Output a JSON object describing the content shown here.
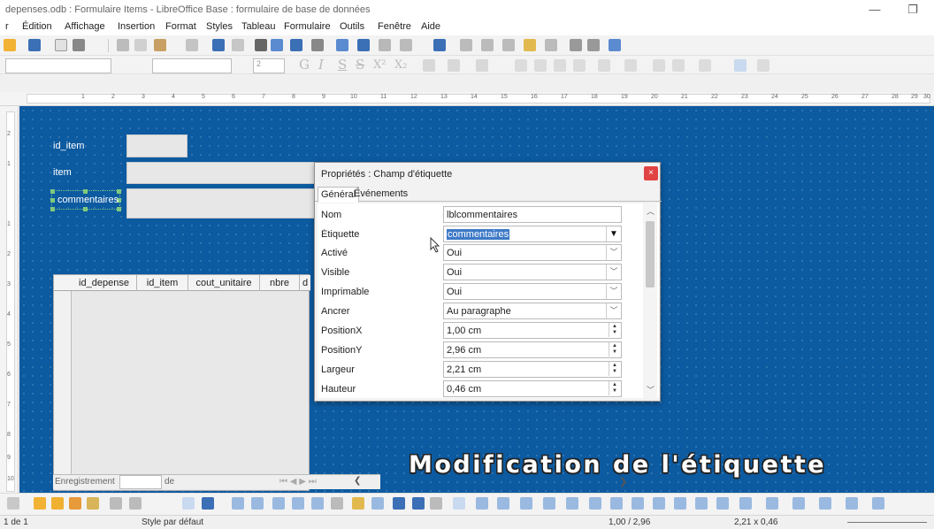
{
  "window": {
    "title": "depenses.odb : Formulaire Items - LibreOffice Base : formulaire de base de données",
    "minimize": "—",
    "restore": "❐"
  },
  "menu": {
    "items": [
      "r",
      "Édition",
      "Affichage",
      "Insertion",
      "Format",
      "Styles",
      "Tableau",
      "Formulaire",
      "Outils",
      "Fenêtre",
      "Aide"
    ]
  },
  "format_toolbar": {
    "font_size": "2",
    "glyphs": [
      "G",
      "I",
      "S",
      "S",
      "X²",
      "X₂"
    ]
  },
  "ruler": {
    "numbers": [
      "1",
      "2",
      "3",
      "4",
      "5",
      "6",
      "7",
      "8",
      "9",
      "10",
      "11",
      "12",
      "13",
      "14",
      "15",
      "16",
      "17",
      "18",
      "19",
      "20",
      "21",
      "22",
      "23",
      "24",
      "25",
      "26",
      "27",
      "28",
      "29",
      "30"
    ],
    "vnumbers": [
      "2",
      "1",
      "1",
      "2",
      "3",
      "4",
      "5",
      "6",
      "7",
      "8",
      "9",
      "10"
    ]
  },
  "form": {
    "labels": {
      "id_item": "id_item",
      "item": "item",
      "commentaires": "commentaires"
    },
    "grid_columns": [
      "id_depense",
      "id_item",
      "cout_unitaire",
      "nbre",
      "d"
    ],
    "nav": {
      "record_label": "Enregistrement",
      "of_label": "de",
      "arrows": "⏮ ◀ ▶ ⏭"
    }
  },
  "overlay": {
    "caption": "Modification de l'étiquette"
  },
  "dialog": {
    "title": "Propriétés : Champ d'étiquette",
    "close": "×",
    "tabs": {
      "general": "Général",
      "events": "Événements"
    },
    "properties": [
      {
        "name": "Nom",
        "value": "lblcommentaires",
        "control": "text"
      },
      {
        "name": "Étiquette",
        "value": "commentaires",
        "control": "combo-dark",
        "selected": true
      },
      {
        "name": "Activé",
        "value": "Oui",
        "control": "dropdown"
      },
      {
        "name": "Visible",
        "value": "Oui",
        "control": "dropdown"
      },
      {
        "name": "Imprimable",
        "value": "Oui",
        "control": "dropdown"
      },
      {
        "name": "Ancrer",
        "value": "Au paragraphe",
        "control": "dropdown"
      },
      {
        "name": "PositionX",
        "value": "1,00 cm",
        "control": "spin"
      },
      {
        "name": "PositionY",
        "value": "2,96 cm",
        "control": "spin"
      },
      {
        "name": "Largeur",
        "value": "2,21 cm",
        "control": "spin"
      },
      {
        "name": "Hauteur",
        "value": "0,46 cm",
        "control": "spin"
      }
    ]
  },
  "statusbar": {
    "page": "1 de 1",
    "style": "Style par défaut",
    "position": "1,00 / 2,96",
    "size": "2,21 x 0,46"
  },
  "colors": {
    "canvas": "#0c5aa0",
    "selection": "#3d79c7",
    "close": "#e04343"
  }
}
